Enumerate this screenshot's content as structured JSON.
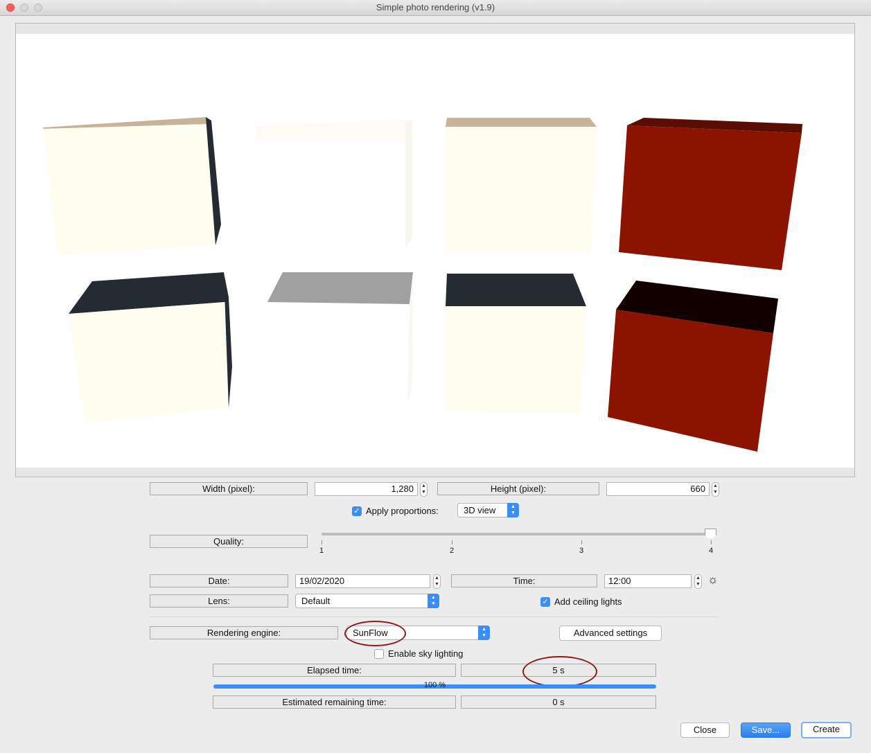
{
  "window": {
    "title": "Simple photo rendering (v1.9)"
  },
  "colors": {
    "accent": "#3a8ef5",
    "render_red": "#8c1300",
    "render_cream": "#fffdf0",
    "render_dark": "#242b33",
    "annotation": "#8b1a1a"
  },
  "size": {
    "width_label": "Width (pixel):",
    "width_value": "1,280",
    "height_label": "Height (pixel):",
    "height_value": "660",
    "apply_proportions_label": "Apply proportions:",
    "apply_proportions_checked": true,
    "proportion_option": "3D view"
  },
  "quality": {
    "label": "Quality:",
    "ticks": [
      "1",
      "2",
      "3",
      "4"
    ],
    "value": 4
  },
  "date": {
    "label": "Date:",
    "value": "19/02/2020"
  },
  "time": {
    "label": "Time:",
    "value": "12:00",
    "icon": "sun-icon"
  },
  "lens": {
    "label": "Lens:",
    "value": "Default"
  },
  "ceiling_lights": {
    "label": "Add ceiling lights",
    "checked": true
  },
  "engine": {
    "label": "Rendering engine:",
    "value": "SunFlow",
    "advanced_label": "Advanced settings"
  },
  "sky_lighting": {
    "label": "Enable sky lighting",
    "checked": false
  },
  "progress": {
    "elapsed_label": "Elapsed time:",
    "elapsed_value": "5 s",
    "percent_text": "100 %",
    "percent": 100,
    "remaining_label": "Estimated remaining time:",
    "remaining_value": "0 s"
  },
  "buttons": {
    "close": "Close",
    "save": "Save...",
    "create": "Create"
  }
}
